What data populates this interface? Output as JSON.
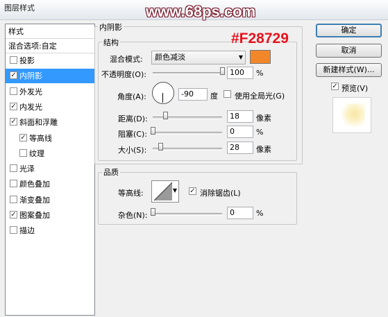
{
  "window": {
    "title": "图层样式"
  },
  "watermark": "www.68ps.com",
  "color_annotation": "#F28729",
  "styles_panel": {
    "header": "样式",
    "blend_options": "混合选项:自定",
    "items": [
      {
        "label": "投影",
        "checked": false,
        "selected": false
      },
      {
        "label": "内阴影",
        "checked": true,
        "selected": true
      },
      {
        "label": "外发光",
        "checked": false,
        "selected": false
      },
      {
        "label": "内发光",
        "checked": true,
        "selected": false
      },
      {
        "label": "斜面和浮雕",
        "checked": true,
        "selected": false
      },
      {
        "label": "等高线",
        "checked": true,
        "selected": false
      },
      {
        "label": "纹理",
        "checked": false,
        "selected": false
      },
      {
        "label": "光泽",
        "checked": false,
        "selected": false
      },
      {
        "label": "颜色叠加",
        "checked": false,
        "selected": false
      },
      {
        "label": "渐变叠加",
        "checked": false,
        "selected": false
      },
      {
        "label": "图案叠加",
        "checked": true,
        "selected": false
      },
      {
        "label": "描边",
        "checked": false,
        "selected": false
      }
    ],
    "check_mark": "✓"
  },
  "inner_shadow": {
    "title": "内阴影",
    "structure": {
      "title": "结构",
      "blend_mode_label": "混合模式:",
      "blend_mode_value": "颜色减淡",
      "swatch_color": "#F28729",
      "opacity_label": "不透明度(O):",
      "opacity_value": "100",
      "opacity_fraction": 1.0,
      "percent": "%",
      "angle_label": "角度(A):",
      "angle_value": "-90",
      "angle_unit": "度",
      "global_light_label": "使用全局光(G)",
      "global_light_checked": false,
      "distance_label": "距离(D):",
      "distance_value": "18",
      "distance_fraction": 0.18,
      "choke_label": "阻塞(C):",
      "choke_value": "0",
      "choke_fraction": 0.0,
      "size_label": "大小(S):",
      "size_value": "28",
      "size_fraction": 0.11,
      "pixels_unit": "像素"
    },
    "quality": {
      "title": "品质",
      "contour_label": "等高线:",
      "antialias_label": "消除锯齿(L)",
      "antialias_checked": true,
      "noise_label": "杂色(N):",
      "noise_value": "0",
      "noise_fraction": 0.0
    }
  },
  "buttons": {
    "ok": "确定",
    "cancel": "取消",
    "new_style": "新建样式(W)...",
    "preview_label": "预览(V)",
    "preview_checked": true
  }
}
